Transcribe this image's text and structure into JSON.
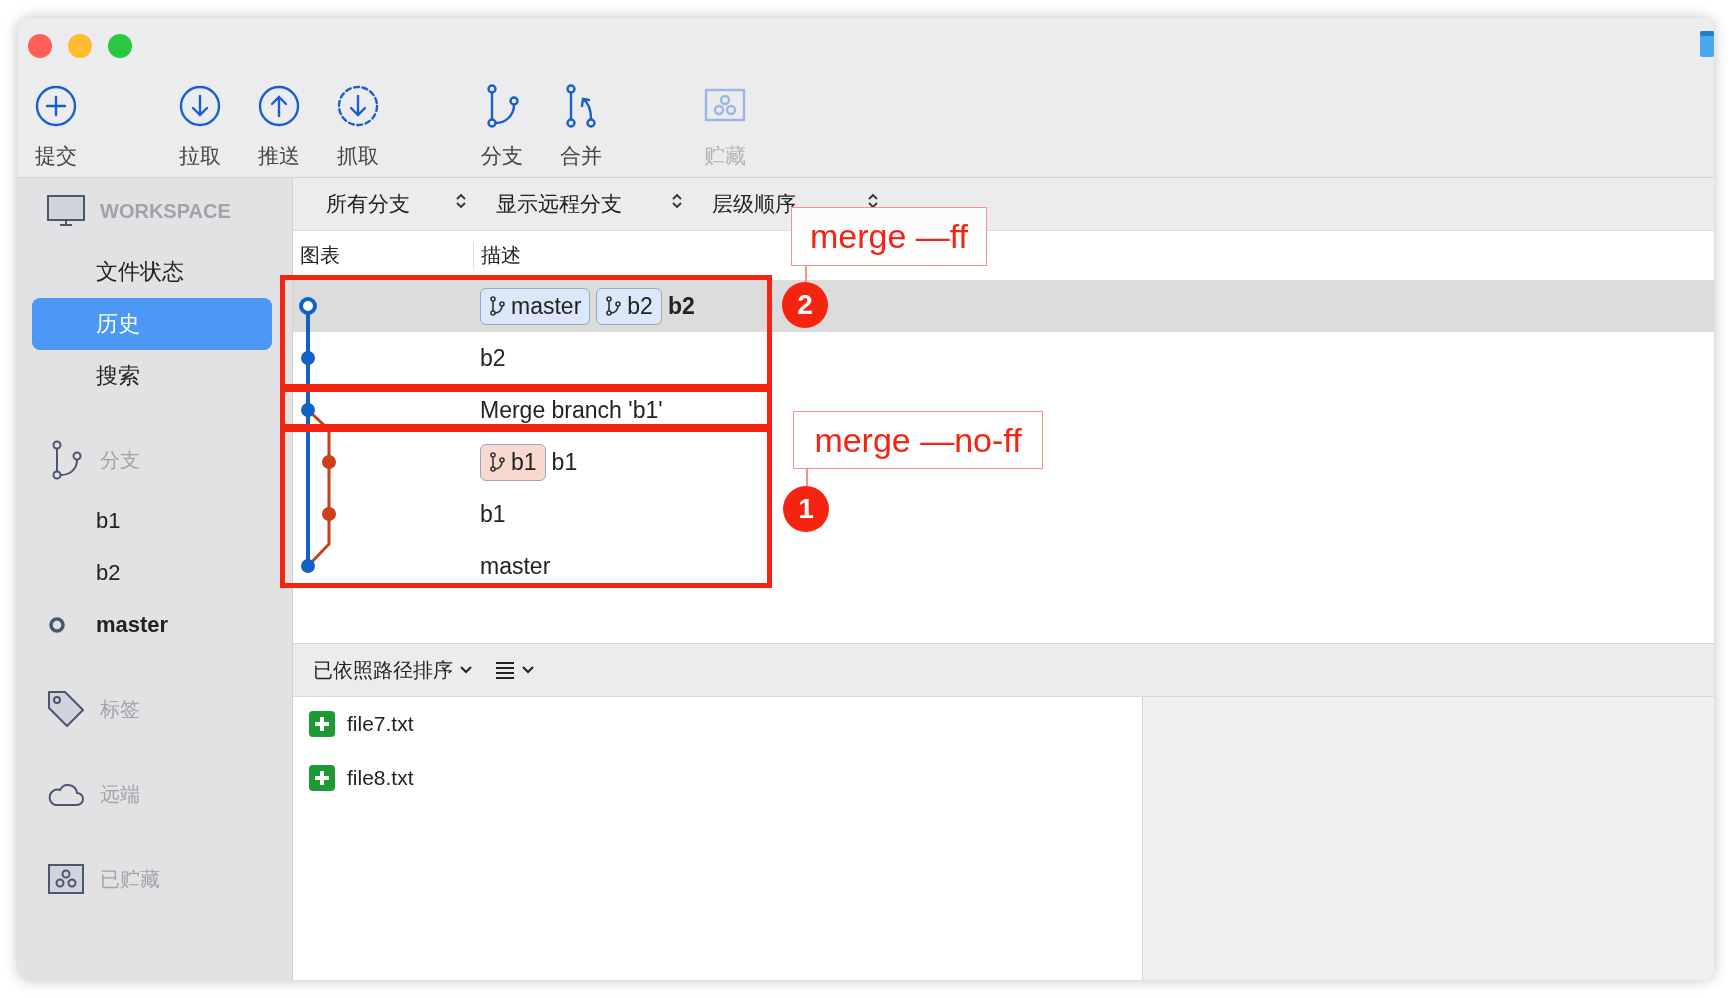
{
  "toolbar": {
    "groups": [
      [
        {
          "kind": "commit",
          "label": "提交",
          "disabled": false
        }
      ],
      [
        {
          "kind": "pull",
          "label": "拉取",
          "disabled": false
        },
        {
          "kind": "push",
          "label": "推送",
          "disabled": false
        },
        {
          "kind": "fetch",
          "label": "抓取",
          "disabled": false
        }
      ],
      [
        {
          "kind": "branch",
          "label": "分支",
          "disabled": false
        },
        {
          "kind": "merge",
          "label": "合并",
          "disabled": false
        }
      ],
      [
        {
          "kind": "stash",
          "label": "贮藏",
          "disabled": true
        }
      ]
    ]
  },
  "sidebar": {
    "sections": [
      {
        "kind": "workspace",
        "label": "WORKSPACE",
        "items": [
          {
            "label": "文件状态",
            "selected": false
          },
          {
            "label": "历史",
            "selected": true
          },
          {
            "label": "搜索",
            "selected": false
          }
        ]
      },
      {
        "kind": "branches",
        "label": "分支",
        "items": [
          {
            "label": "b1",
            "selected": false,
            "current": false
          },
          {
            "label": "b2",
            "selected": false,
            "current": false
          },
          {
            "label": "master",
            "selected": false,
            "current": true
          }
        ]
      },
      {
        "kind": "tags",
        "label": "标签"
      },
      {
        "kind": "remotes",
        "label": "远端"
      },
      {
        "kind": "stashes",
        "label": "已贮藏"
      }
    ]
  },
  "filter_bar": {
    "dropdowns": [
      "所有分支",
      "显示远程分支",
      "层级顺序"
    ]
  },
  "commit_table": {
    "columns": [
      "图表",
      "描述"
    ],
    "rows": [
      {
        "selected": true,
        "head": true,
        "refs": [
          {
            "name": "master",
            "color": "#dbe8fb"
          },
          {
            "name": "b2",
            "color": "#dbe8fb"
          }
        ],
        "message": "b2"
      },
      {
        "selected": false,
        "head": false,
        "message": "b2"
      },
      {
        "selected": false,
        "head": false,
        "message": "Merge branch 'b1'"
      },
      {
        "selected": false,
        "head": false,
        "refs": [
          {
            "name": "b1",
            "color": "#f9d9cf"
          }
        ],
        "message": "b1"
      },
      {
        "selected": false,
        "head": false,
        "message": "b1"
      },
      {
        "selected": false,
        "head": false,
        "message": "master"
      }
    ]
  },
  "file_toolbar": {
    "sort": "已依照路径排序"
  },
  "files": [
    {
      "name": "file7.txt",
      "added": true
    },
    {
      "name": "file8.txt",
      "added": true
    }
  ],
  "annotations": {
    "callouts": [
      {
        "label": "merge —ff",
        "number": "2"
      },
      {
        "label": "merge —no-ff",
        "number": "1"
      }
    ]
  }
}
